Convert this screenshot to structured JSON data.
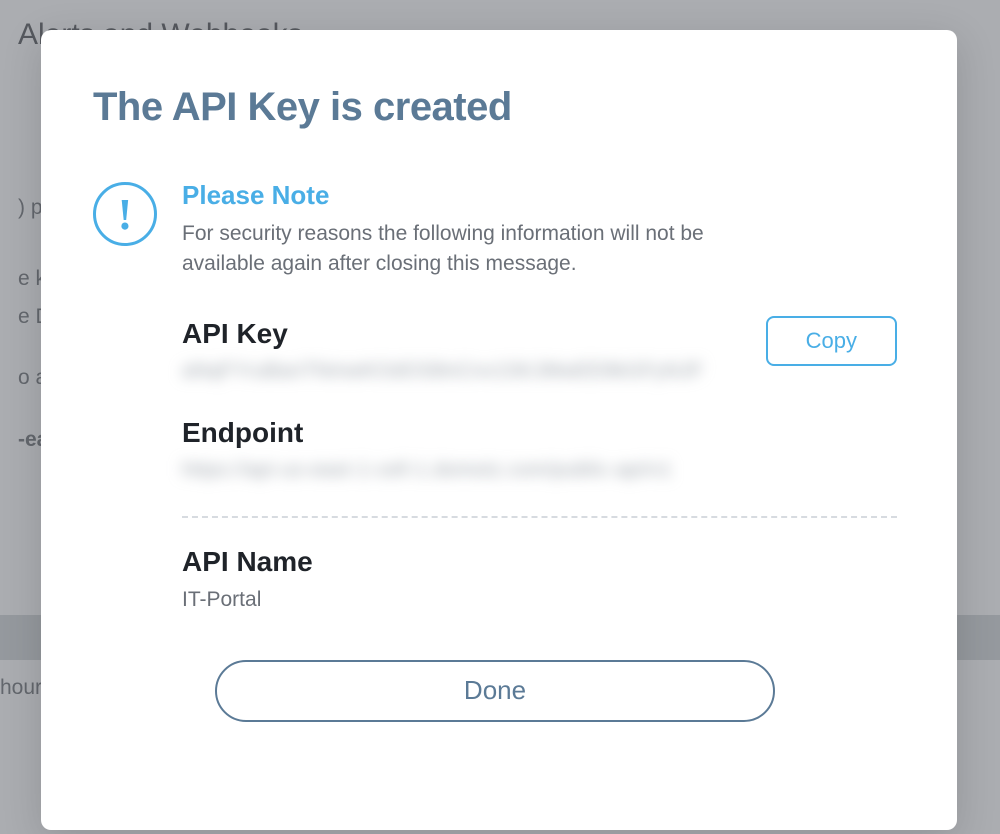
{
  "background": {
    "page_title": "Alerts and Webhooks",
    "fragments": [
      ") pro",
      "e ke",
      "e Do",
      "o acc",
      "-eas",
      "hour"
    ]
  },
  "modal": {
    "title": "The API Key is created",
    "note": {
      "heading": "Please Note",
      "body": "For security reasons the following information will not be available again after closing this message."
    },
    "api_key": {
      "label": "API Key",
      "value": "aNqFYruBanTNmwKOdOS8nCnv1SKJMwEE8kGFyNJF",
      "copy_label": "Copy"
    },
    "endpoint": {
      "label": "Endpoint",
      "value": "https://api-us-east-1-cell-1.domotz.com/public-api/v1"
    },
    "api_name": {
      "label": "API Name",
      "value": "IT-Portal"
    },
    "done_label": "Done"
  }
}
